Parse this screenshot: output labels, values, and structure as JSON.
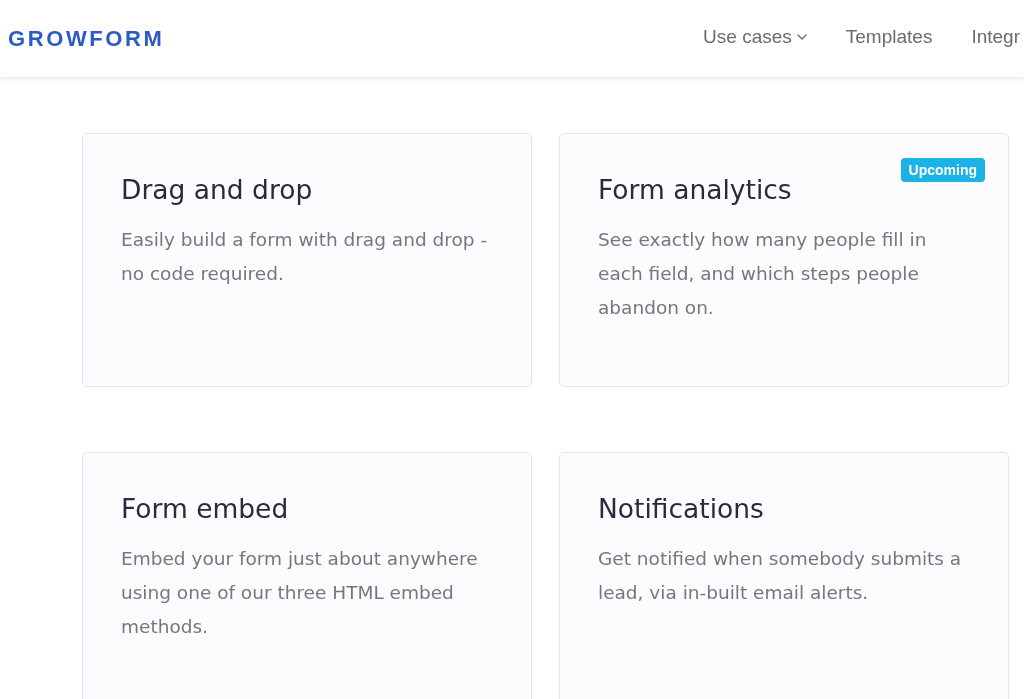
{
  "header": {
    "logo": "GROWFORM",
    "nav": [
      {
        "label": "Use cases",
        "kind": "dropdown"
      },
      {
        "label": "Templates",
        "kind": "link"
      },
      {
        "label": "Integr",
        "kind": "link"
      }
    ]
  },
  "feature_rows": [
    {
      "features": [
        {
          "title": "Drag and drop",
          "description": "Easily build a form with drag and drop - no code required."
        },
        {
          "title": "Form analytics",
          "description": "See exactly how many people fill in each field, and which steps people abandon on.",
          "badge": "Upcoming"
        }
      ]
    },
    {
      "features": [
        {
          "title": "Form embed",
          "description": "Embed your form just about anywhere using one of our three HTML embed methods."
        },
        {
          "title": "Notifications",
          "description": "Get notified when somebody submits a lead, via in-built email alerts."
        }
      ]
    }
  ]
}
